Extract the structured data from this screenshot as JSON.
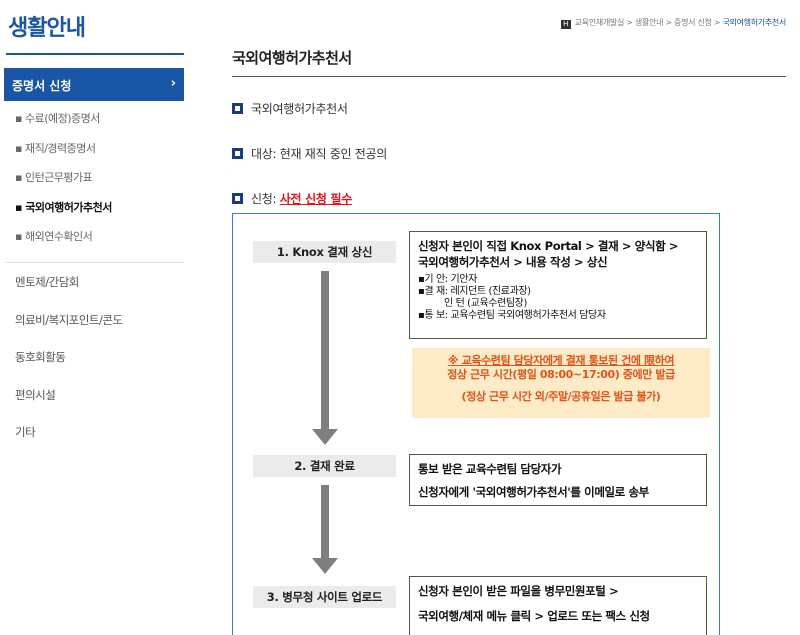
{
  "sidebar": {
    "title": "생활안내",
    "active_item": "증명서 신청",
    "active_chevron": "›",
    "sub_items": [
      "▪ 수료(예정)증명서",
      "▪ 재직/경력증명서",
      "▪ 인턴근무평가표",
      "▪ 국외여행허가추천서",
      "▪ 해외연수확인서"
    ],
    "main_items": [
      "멘토제/간담회",
      "의료비/복지포인트/콘도",
      "동호회활동",
      "편의시설",
      "기타"
    ]
  },
  "breadcrumb": {
    "home_icon": "home-icon",
    "home_glyph": "H",
    "trail": "교육인재개발실 > 생활안내 > 증명서 신청 > ",
    "current": "국외여행허가추천서"
  },
  "main": {
    "title": "국외여행허가추천서",
    "sections": [
      {
        "label": "국외여행허가추천서"
      },
      {
        "label": "대상: 현재 재직 중인 전공의"
      },
      {
        "label": "신청: ",
        "emphasis": "사전 신청 필수"
      }
    ]
  },
  "process": {
    "steps": [
      "1. Knox 결재 상신",
      "2. 결재 완료",
      "3. 병무청 사이트 업로드"
    ],
    "step1_desc": {
      "line1": "신청자 본인이 직접 Knox Portal > 결재 > 양식함 >",
      "line2": "국외여행허가추천서 > 내용 작성 > 상신",
      "d1": "▪기  안: 기안자",
      "d2": "▪결  재: 레지던트 (진료과장)",
      "d3": "인  턴 (교육수련팀장)",
      "d4": "▪통  보: 교육수련팀 국외여행허가추천서 담당자"
    },
    "note": {
      "line1": "※ 교육수련팀 담당자에게 결재 통보된 건에 限하여",
      "line2": "정상 근무 시간(평일 08:00~17:00) 중에만 발급",
      "line3": "(정상 근무 시간 외/주말/공휴일은 발급 불가)"
    },
    "step2_desc": {
      "line1": "통보 받은 교육수련팀 담당자가",
      "line2": "신청자에게 '국외여행허가추천서'를 이메일로 송부"
    },
    "step3_desc": {
      "line1": "신청자 본인이 받은 파일을 병무민원포털 >",
      "line2": "국외여행/체재 메뉴 클릭 > 업로드 또는 팩스 신청"
    }
  },
  "colors": {
    "brand": "#1a56a6",
    "emphasis": "#e8121a",
    "note_bg": "#fdebc8",
    "note_text": "#e0541a"
  }
}
